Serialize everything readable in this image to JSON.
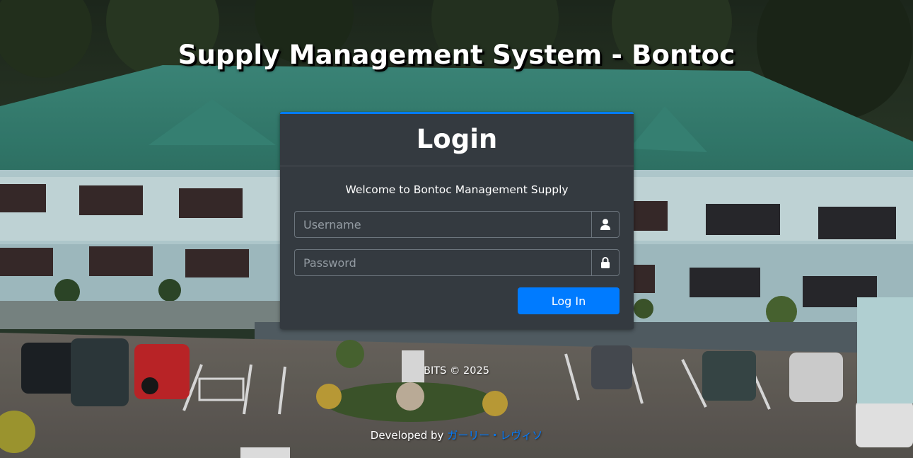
{
  "site": {
    "title": "Supply Management System - Bontoc"
  },
  "login": {
    "title": "Login",
    "welcome": "Welcome to Bontoc Management Supply",
    "username_placeholder": "Username",
    "username_value": "",
    "username_icon": "user-icon",
    "password_placeholder": "Password",
    "password_value": "",
    "password_icon": "lock-icon",
    "submit_label": "Log In"
  },
  "footer": {
    "copyright": "BITS © 2025",
    "developed_prefix": "Developed by ",
    "developer_name": "ガーリー・レヴィソ"
  },
  "colors": {
    "accent": "#007bff",
    "card_bg": "#343a40",
    "text": "#ffffff"
  }
}
